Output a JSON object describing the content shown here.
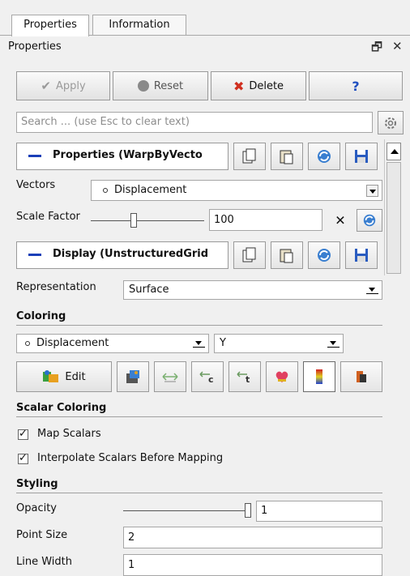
{
  "tabs": [
    {
      "label": "Properties"
    },
    {
      "label": "Information"
    }
  ],
  "dock": {
    "title": "Properties",
    "float_glyph": "🗗",
    "close_glyph": "✕"
  },
  "toolbar": {
    "apply_label": "Apply",
    "reset_label": "Reset",
    "delete_label": "Delete",
    "help_label": "?"
  },
  "search": {
    "placeholder": "Search ... (use Esc to clear text)"
  },
  "properties_group": {
    "title": "Properties (WarpByVecto"
  },
  "vectors": {
    "label": "Vectors",
    "value": "Displacement"
  },
  "scale_factor": {
    "label": "Scale Factor",
    "value": "100",
    "slider_level": 0.38
  },
  "display_group": {
    "title": "Display (UnstructuredGrid"
  },
  "representation": {
    "label": "Representation",
    "value": "Surface"
  },
  "coloring": {
    "section": "Coloring",
    "array": "Displacement",
    "component": "Y",
    "edit_label": "Edit"
  },
  "scalar_coloring": {
    "section": "Scalar Coloring",
    "map_scalars": "Map Scalars",
    "interpolate": "Interpolate Scalars Before Mapping"
  },
  "styling": {
    "section": "Styling",
    "opacity_label": "Opacity",
    "opacity_value": "1",
    "opacity_level": 1.0,
    "point_size_label": "Point Size",
    "point_size_value": "2",
    "line_width_label": "Line Width",
    "line_width_value": "1"
  },
  "colors": {
    "accent_blue": "#1a3fb8",
    "delete_red": "#d03020",
    "help_blue": "#2050c0"
  }
}
